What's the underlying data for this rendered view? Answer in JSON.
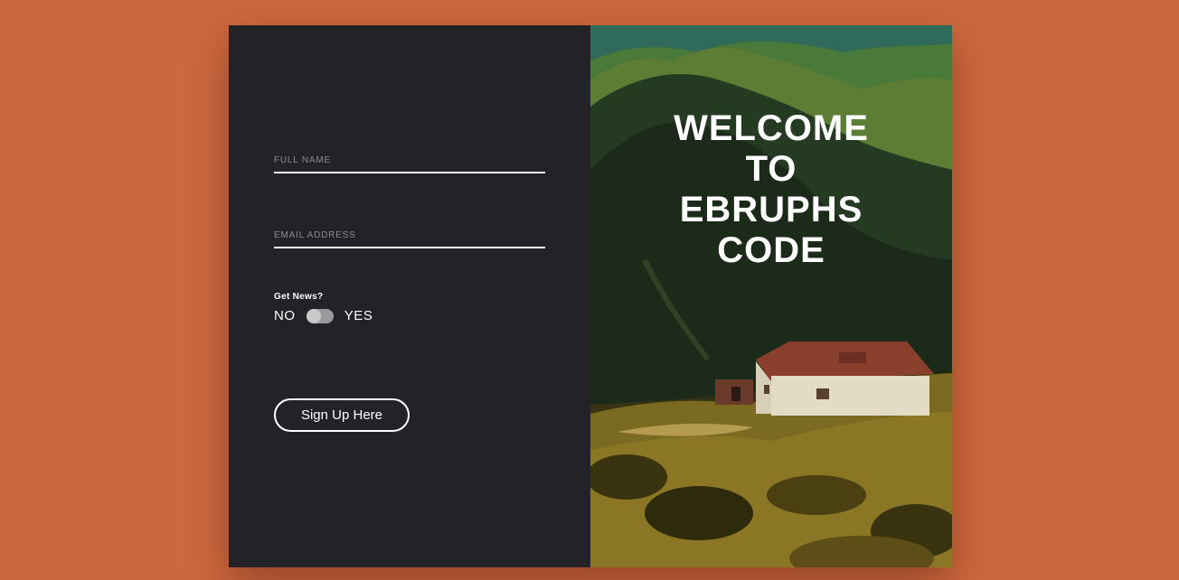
{
  "form": {
    "full_name_placeholder": "FULL NAME",
    "full_name_value": "",
    "email_placeholder": "EMAIL ADDRESS",
    "email_value": "",
    "news_label": "Get News?",
    "toggle_off_label": "NO",
    "toggle_on_label": "YES",
    "toggle_state": "off",
    "submit_label": "Sign Up Here"
  },
  "hero": {
    "welcome_text": "WELCOME\nTO\nEBRUPHS\nCODE",
    "image": "mountain-house-landscape"
  },
  "colors": {
    "background": "#cc683f",
    "form_panel": "#232227",
    "text": "#ffffff",
    "placeholder": "#8a8a8f"
  }
}
